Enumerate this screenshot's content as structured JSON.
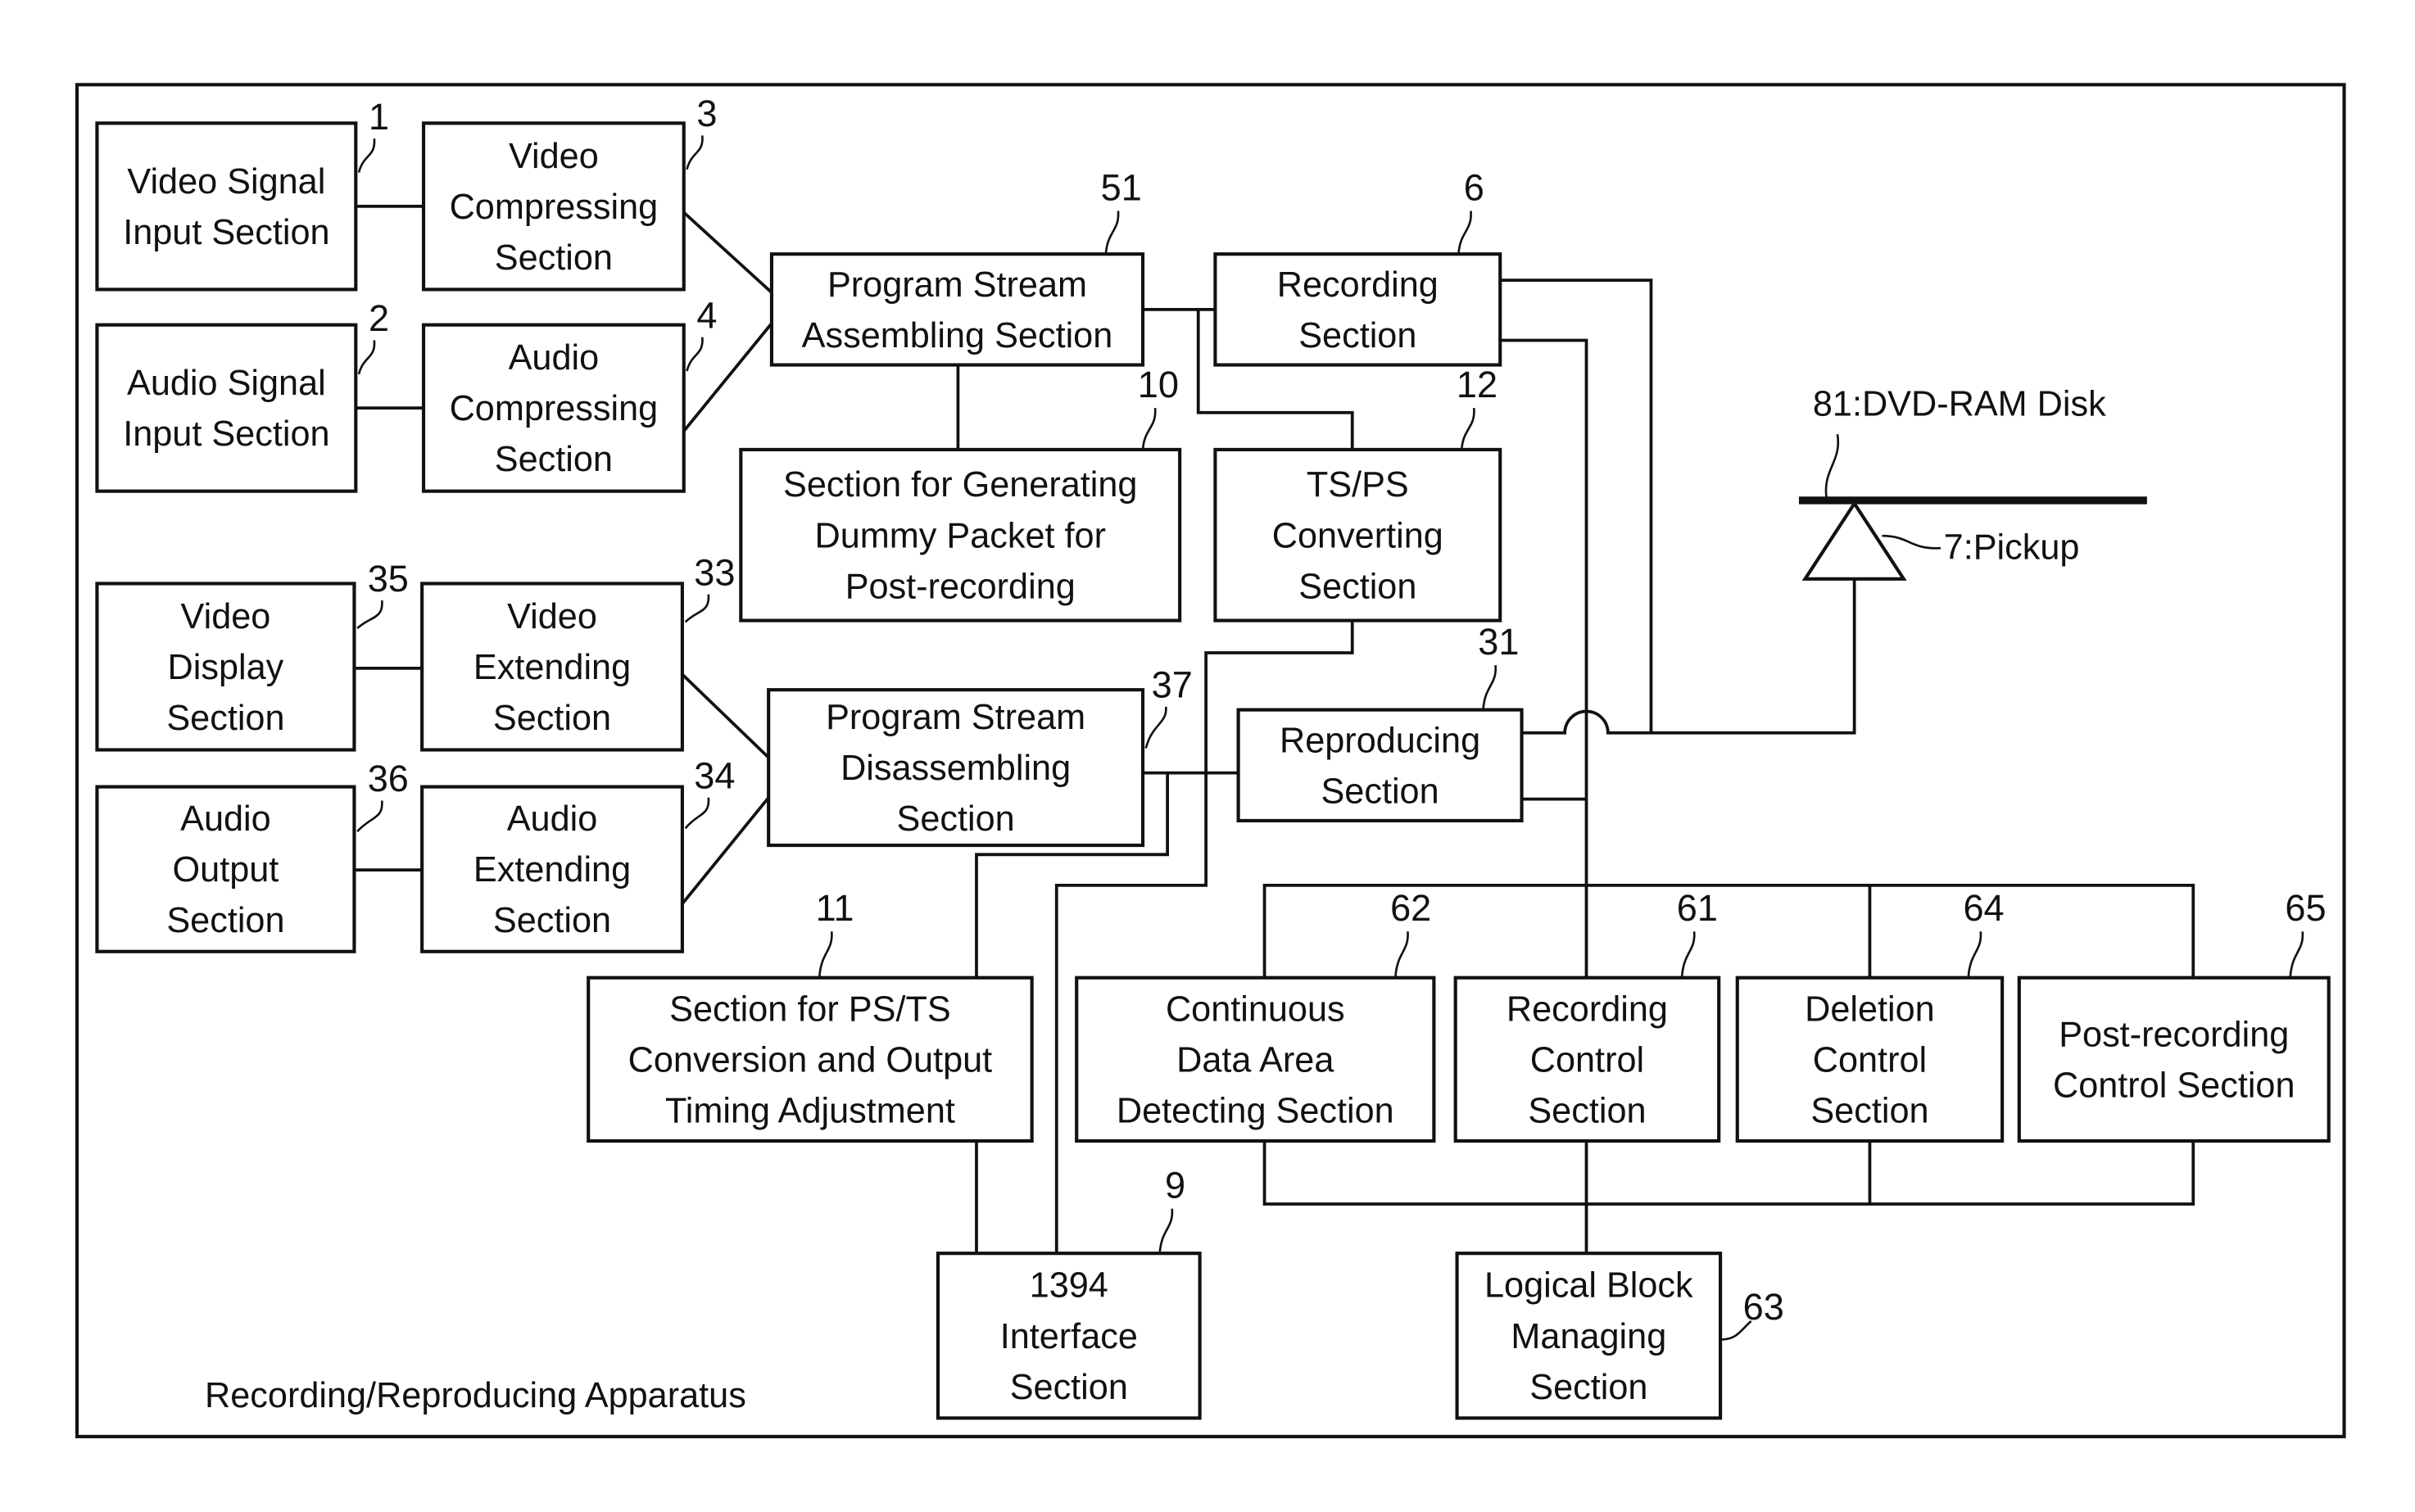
{
  "diagram": {
    "caption": "Recording/Reproducing Apparatus",
    "disk_label": "81:DVD-RAM Disk",
    "pickup_label": "7:Pickup",
    "boxes": [
      {
        "id": "video-signal-input",
        "ref": "1",
        "lines": [
          "Video Signal",
          "Input Section"
        ]
      },
      {
        "id": "audio-signal-input",
        "ref": "2",
        "lines": [
          "Audio Signal",
          "Input Section"
        ]
      },
      {
        "id": "video-compressing",
        "ref": "3",
        "lines": [
          "Video",
          "Compressing",
          "Section"
        ]
      },
      {
        "id": "audio-compressing",
        "ref": "4",
        "lines": [
          "Audio",
          "Compressing",
          "Section"
        ]
      },
      {
        "id": "program-stream-assembling",
        "ref": "51",
        "lines": [
          "Program Stream",
          "Assembling Section"
        ]
      },
      {
        "id": "recording",
        "ref": "6",
        "lines": [
          "Recording",
          "Section"
        ]
      },
      {
        "id": "dummy-packet-generating",
        "ref": "10",
        "lines": [
          "Section for Generating",
          "Dummy Packet for",
          "Post-recording"
        ]
      },
      {
        "id": "ts-ps-converting",
        "ref": "12",
        "lines": [
          "TS/PS",
          "Converting",
          "Section"
        ]
      },
      {
        "id": "video-display",
        "ref": "35",
        "lines": [
          "Video",
          "Display",
          "Section"
        ]
      },
      {
        "id": "video-extending",
        "ref": "33",
        "lines": [
          "Video",
          "Extending",
          "Section"
        ]
      },
      {
        "id": "audio-output",
        "ref": "36",
        "lines": [
          "Audio",
          "Output",
          "Section"
        ]
      },
      {
        "id": "audio-extending",
        "ref": "34",
        "lines": [
          "Audio",
          "Extending",
          "Section"
        ]
      },
      {
        "id": "program-stream-disassembling",
        "ref": "37",
        "lines": [
          "Program Stream",
          "Disassembling",
          "Section"
        ]
      },
      {
        "id": "reproducing",
        "ref": "31",
        "lines": [
          "Reproducing",
          "Section"
        ]
      },
      {
        "id": "ps-ts-conversion-output-timing",
        "ref": "11",
        "lines": [
          "Section for PS/TS",
          "Conversion and Output",
          "Timing Adjustment"
        ]
      },
      {
        "id": "continuous-data-area-detecting",
        "ref": "62",
        "lines": [
          "Continuous",
          "Data Area",
          "Detecting Section"
        ]
      },
      {
        "id": "recording-control",
        "ref": "61",
        "lines": [
          "Recording",
          "Control",
          "Section"
        ]
      },
      {
        "id": "deletion-control",
        "ref": "64",
        "lines": [
          "Deletion",
          "Control",
          "Section"
        ]
      },
      {
        "id": "post-recording-control",
        "ref": "65",
        "lines": [
          "Post-recording",
          "Control Section"
        ]
      },
      {
        "id": "ieee1394-interface",
        "ref": "9",
        "lines": [
          "1394",
          "Interface",
          "Section"
        ]
      },
      {
        "id": "logical-block-managing",
        "ref": "63",
        "lines": [
          "Logical Block",
          "Managing",
          "Section"
        ]
      }
    ]
  }
}
